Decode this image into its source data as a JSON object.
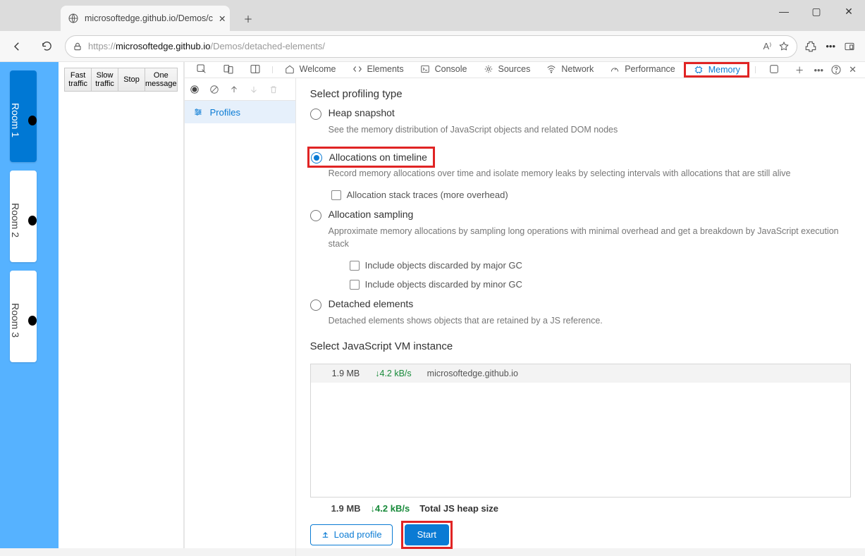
{
  "window": {
    "tab_title": "microsoftedge.github.io/Demos/c",
    "url_prefix": "https://",
    "url_host": "microsoftedge.github.io",
    "url_path": "/Demos/detached-elements/"
  },
  "page": {
    "rooms": [
      "Room 1",
      "Room 2",
      "Room 3"
    ],
    "traffic_buttons": [
      "Fast traffic",
      "Slow traffic",
      "Stop",
      "One message"
    ]
  },
  "devtools": {
    "tabs": [
      "Welcome",
      "Elements",
      "Console",
      "Sources",
      "Network",
      "Performance",
      "Memory"
    ],
    "sidebar_item": "Profiles",
    "memory": {
      "heading": "Select profiling type",
      "options": [
        {
          "label": "Heap snapshot",
          "desc": "See the memory distribution of JavaScript objects and related DOM nodes"
        },
        {
          "label": "Allocations on timeline",
          "desc": "Record memory allocations over time and isolate memory leaks by selecting intervals with allocations that are still alive"
        },
        {
          "label": "Allocation sampling",
          "desc": "Approximate memory allocations by sampling long operations with minimal overhead and get a breakdown by JavaScript execution stack"
        },
        {
          "label": "Detached elements",
          "desc": "Detached elements shows objects that are retained by a JS reference."
        }
      ],
      "stack_traces_label": "Allocation stack traces (more overhead)",
      "gc_major_label": "Include objects discarded by major GC",
      "gc_minor_label": "Include objects discarded by minor GC",
      "vm_heading": "Select JavaScript VM instance",
      "vm_row": {
        "size": "1.9 MB",
        "rate": "↓4.2 kB/s",
        "host": "microsoftedge.github.io"
      },
      "footer": {
        "size": "1.9 MB",
        "rate": "↓4.2 kB/s",
        "label": "Total JS heap size"
      },
      "load_label": "Load profile",
      "start_label": "Start"
    }
  }
}
